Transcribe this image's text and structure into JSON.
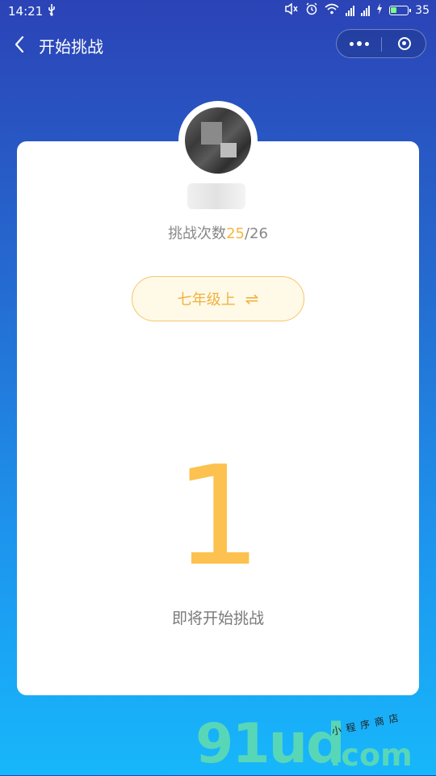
{
  "status_bar": {
    "time": "14:21",
    "usb_icon": "usb-icon",
    "battery_level": "35",
    "battery_color": "#7dff7d"
  },
  "navbar": {
    "title": "开始挑战",
    "back_icon": "chevron-left-icon",
    "more_icon": "more-dots-icon",
    "close_icon": "target-close-icon"
  },
  "challenge": {
    "attempts_label": "挑战次数",
    "attempts_used": "25",
    "attempts_total": "/26",
    "grade_label": "七年级上",
    "grade_swap_icon": "⇌",
    "countdown": "1",
    "status": "即将开始挑战"
  },
  "watermark": {
    "main": "91ud",
    "domain": ".com",
    "tagline": "小程序商店"
  },
  "colors": {
    "accent": "#f5b73b",
    "countdown": "#fcc14f",
    "gradient_top": "#2b43b6",
    "gradient_bottom": "#17b7fb"
  }
}
